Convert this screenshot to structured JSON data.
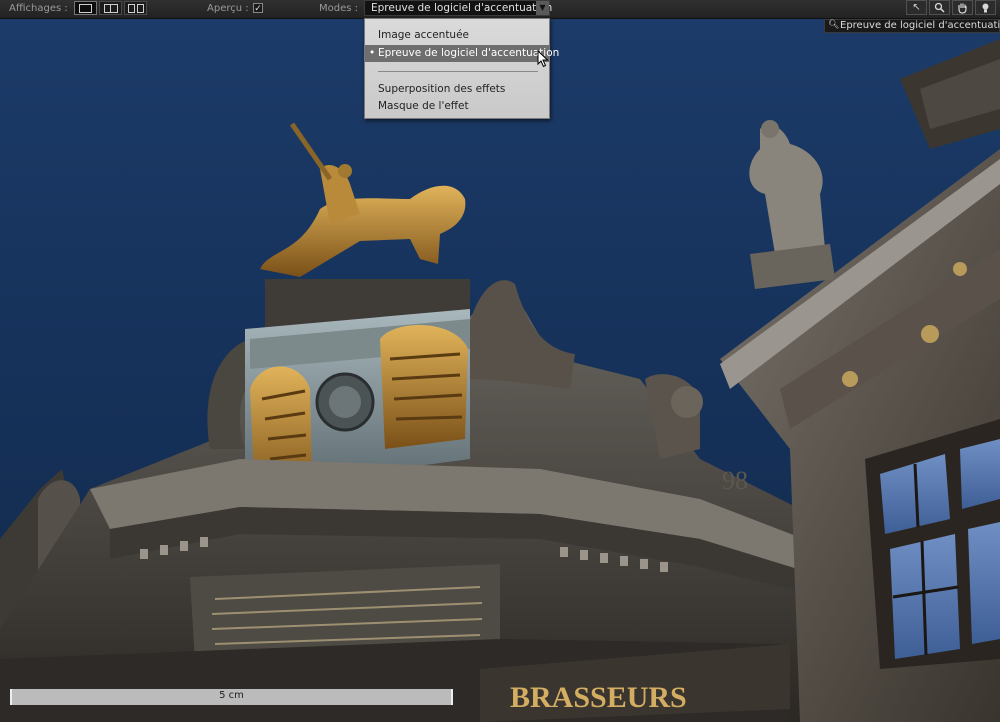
{
  "toolbar": {
    "views_label": "Affichages :",
    "preview_label": "Aperçu :",
    "preview_checked": "✓",
    "modes_label": "Modes :",
    "mode_selected": "Epreuve de logiciel d'accentuation",
    "dropdown_arrow": "▼",
    "tools": [
      "select-arrow-icon",
      "zoom-icon",
      "hand-icon",
      "light-icon"
    ]
  },
  "mode_menu": {
    "items": [
      "Image accentuée",
      "Epreuve de logiciel d'accentuation",
      "Superposition des effets",
      "Masque de l'effet"
    ],
    "selected_index": 1,
    "selected_marker": "•"
  },
  "search_tag": {
    "icon": "search-icon",
    "text": "Epreuve de logiciel d'accentuation"
  },
  "scale_bar": {
    "label": "5 cm"
  },
  "photo": {
    "sign_text": "BRASSEURS",
    "sky_color": "#1a3866"
  },
  "colors": {
    "toolbar_bg": "#262626",
    "menu_bg": "#d4d4d4",
    "menu_selected": "#6e6e6e",
    "gold": "#c79a3a"
  }
}
